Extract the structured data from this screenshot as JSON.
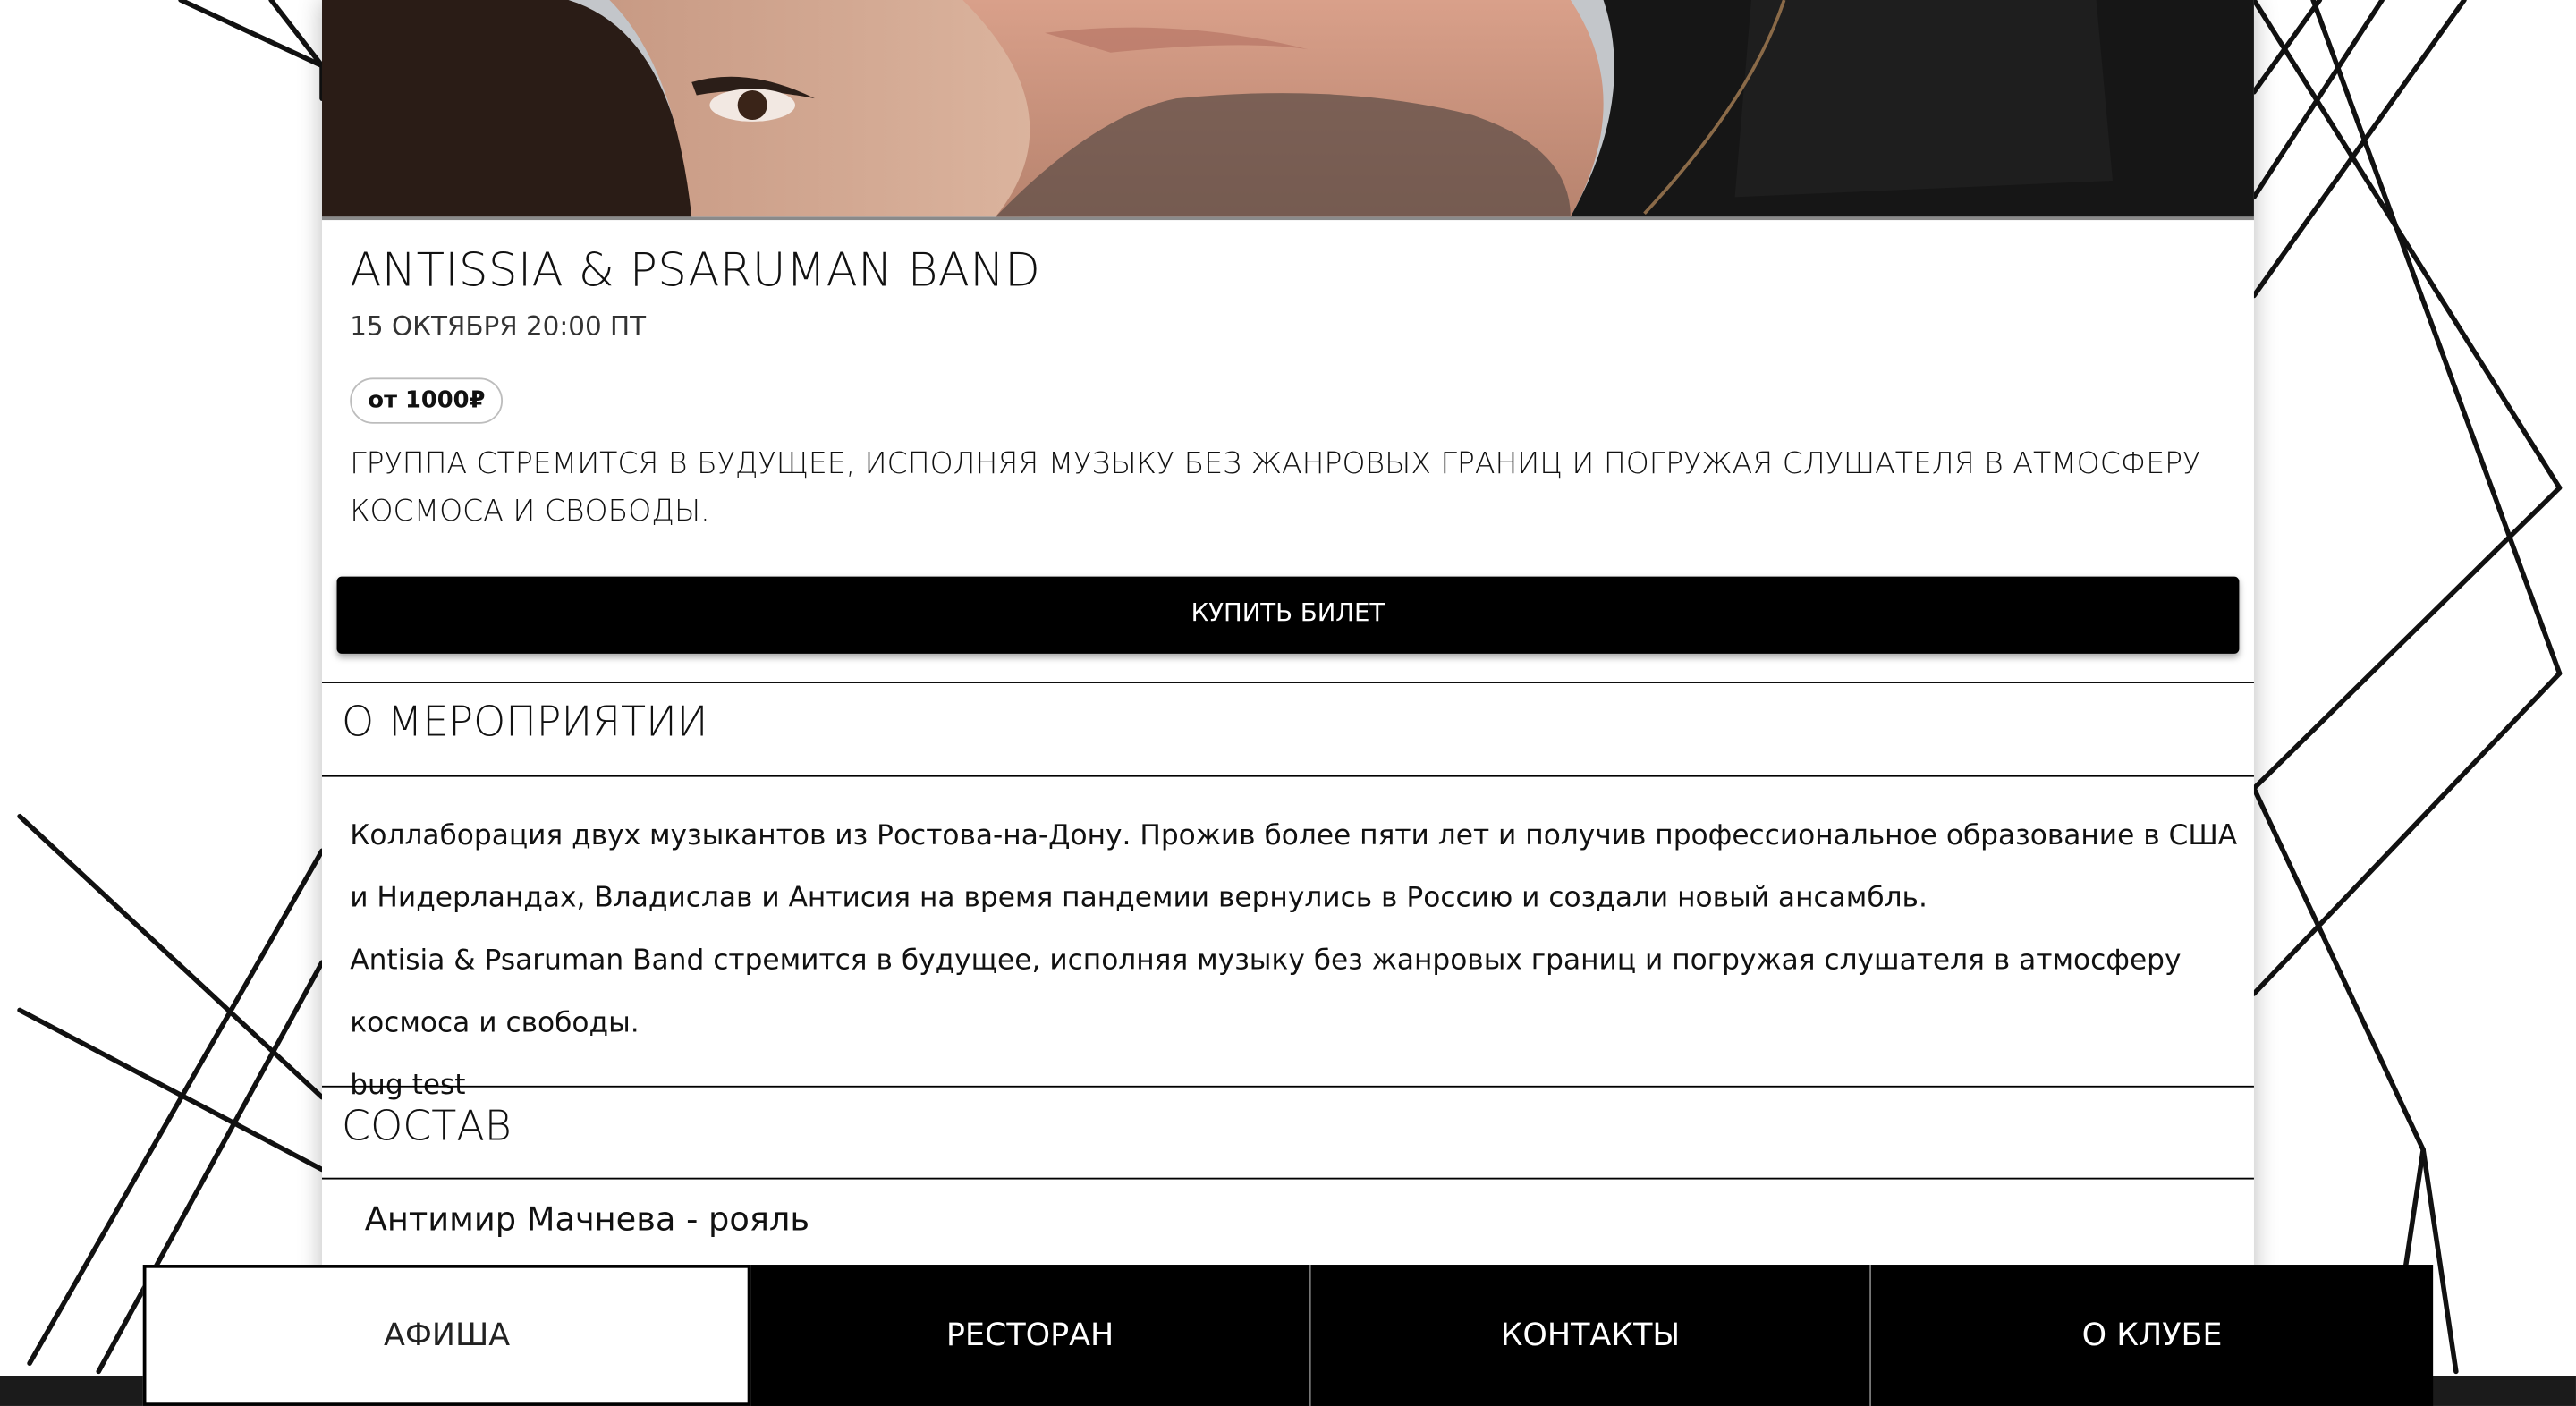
{
  "event": {
    "title": "ANTISSIA & PSARUMAN BAND",
    "datetime": "15 ОКТЯБРЯ 20:00 ПТ",
    "price": "от 1000₽",
    "short_description": "ГРУППА СТРЕМИТСЯ В БУДУЩЕЕ, ИСПОЛНЯЯ МУЗЫКУ БЕЗ ЖАНРОВЫХ ГРАНИЦ И ПОГРУЖАЯ СЛУШАТЕЛЯ В АТМОСФЕРУ КОСМОСА И СВОБОДЫ.",
    "buy_label": "КУПИТЬ БИЛЕТ"
  },
  "about": {
    "heading": "О МЕРОПРИЯТИИ",
    "paragraphs": [
      "Коллаборация двух музыкантов из Ростова-на-Дону. Прожив более пяти лет и получив профессиональное образование в США и Нидерландах, Владислав и Антисия на время пандемии вернулись в Россию и создали новый ансамбль.",
      "Antisia & Psaruman Band стремится в будущее, исполняя музыку без жанровых границ и погружая слушателя в атмосферу космоса и свободы.",
      "bug test"
    ]
  },
  "lineup": {
    "heading": "СОСТАВ",
    "members": [
      "Антимир Мачнева - рояль"
    ]
  },
  "nav": {
    "items": [
      "АФИША",
      "РЕСТОРАН",
      "КОНТАКТЫ",
      "О КЛУБЕ"
    ],
    "active": "АФИША"
  },
  "colors": {
    "background": "#ffffff",
    "button": "#000000",
    "nav_background": "#000000",
    "nav_active": "#ffffff"
  }
}
